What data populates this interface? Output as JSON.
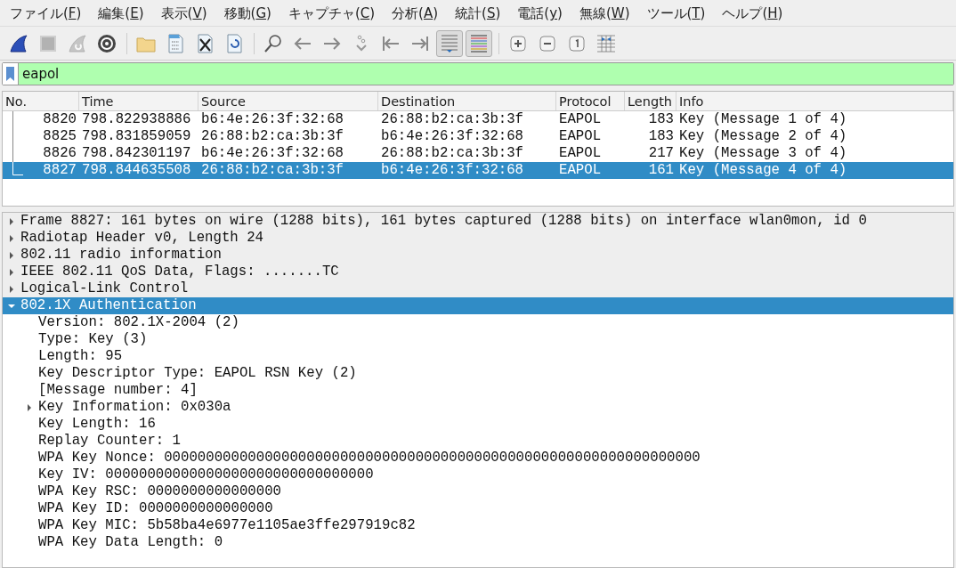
{
  "menu": [
    {
      "before": "ファイル(",
      "accel": "F",
      "after": ")"
    },
    {
      "before": "編集(",
      "accel": "E",
      "after": ")"
    },
    {
      "before": "表示(",
      "accel": "V",
      "after": ")"
    },
    {
      "before": "移動(",
      "accel": "G",
      "after": ")"
    },
    {
      "before": "キャプチャ(",
      "accel": "C",
      "after": ")"
    },
    {
      "before": "分析(",
      "accel": "A",
      "after": ")"
    },
    {
      "before": "統計(",
      "accel": "S",
      "after": ")"
    },
    {
      "before": "電話(",
      "accel": "y",
      "after": ")"
    },
    {
      "before": "無線(",
      "accel": "W",
      "after": ")"
    },
    {
      "before": "ツール(",
      "accel": "T",
      "after": ")"
    },
    {
      "before": "ヘルプ(",
      "accel": "H",
      "after": ")"
    }
  ],
  "toolbar": [
    [
      {
        "kind": "start",
        "pressed": false,
        "disabled": false
      },
      {
        "kind": "stop",
        "pressed": false,
        "disabled": true
      },
      {
        "kind": "restart",
        "pressed": false,
        "disabled": true
      },
      {
        "kind": "options",
        "pressed": false,
        "disabled": false
      }
    ],
    [
      {
        "kind": "open",
        "pressed": false,
        "disabled": false
      },
      {
        "kind": "save",
        "pressed": false,
        "disabled": false
      },
      {
        "kind": "close",
        "pressed": false,
        "disabled": false
      },
      {
        "kind": "reload",
        "pressed": false,
        "disabled": false
      }
    ],
    [
      {
        "kind": "find",
        "pressed": false,
        "disabled": false
      },
      {
        "kind": "back",
        "pressed": false,
        "disabled": false
      },
      {
        "kind": "forward",
        "pressed": false,
        "disabled": false
      },
      {
        "kind": "goto",
        "pressed": false,
        "disabled": false
      },
      {
        "kind": "first",
        "pressed": false,
        "disabled": false
      },
      {
        "kind": "last",
        "pressed": false,
        "disabled": false
      },
      {
        "kind": "autoscroll",
        "pressed": true,
        "disabled": false
      },
      {
        "kind": "colorize",
        "pressed": true,
        "disabled": false
      }
    ],
    [
      {
        "kind": "zoom-in",
        "pressed": false,
        "disabled": false
      },
      {
        "kind": "zoom-out",
        "pressed": false,
        "disabled": false
      },
      {
        "kind": "zoom-reset",
        "pressed": false,
        "disabled": false
      },
      {
        "kind": "resize-columns",
        "pressed": false,
        "disabled": false
      }
    ]
  ],
  "filter": {
    "value": "eapol",
    "valid": true
  },
  "packet_list": {
    "columns": [
      "No.",
      "Time",
      "Source",
      "Destination",
      "Protocol",
      "Length",
      "Info"
    ],
    "rows": [
      {
        "no": "8820",
        "time": "798.822938886",
        "source": "b6:4e:26:3f:32:68",
        "destination": "26:88:b2:ca:3b:3f",
        "protocol": "EAPOL",
        "length": "183",
        "info": "Key (Message 1 of 4)",
        "selected": false
      },
      {
        "no": "8825",
        "time": "798.831859059",
        "source": "26:88:b2:ca:3b:3f",
        "destination": "b6:4e:26:3f:32:68",
        "protocol": "EAPOL",
        "length": "183",
        "info": "Key (Message 2 of 4)",
        "selected": false
      },
      {
        "no": "8826",
        "time": "798.842301197",
        "source": "b6:4e:26:3f:32:68",
        "destination": "26:88:b2:ca:3b:3f",
        "protocol": "EAPOL",
        "length": "217",
        "info": "Key (Message 3 of 4)",
        "selected": false
      },
      {
        "no": "8827",
        "time": "798.844635508",
        "source": "26:88:b2:ca:3b:3f",
        "destination": "b6:4e:26:3f:32:68",
        "protocol": "EAPOL",
        "length": "161",
        "info": "Key (Message 4 of 4)",
        "selected": true
      }
    ]
  },
  "packet_details": [
    {
      "text": "Frame 8827: 161 bytes on wire (1288 bits), 161 bytes captured (1288 bits) on interface wlan0mon, id 0",
      "expanded": false,
      "selected": false
    },
    {
      "text": "Radiotap Header v0, Length 24",
      "expanded": false,
      "selected": false
    },
    {
      "text": "802.11 radio information",
      "expanded": false,
      "selected": false
    },
    {
      "text": "IEEE 802.11 QoS Data, Flags: .......TC",
      "expanded": false,
      "selected": false
    },
    {
      "text": "Logical-Link Control",
      "expanded": false,
      "selected": false
    },
    {
      "text": "802.1X Authentication",
      "expanded": true,
      "selected": true,
      "children": [
        {
          "text": "Version: 802.1X-2004 (2)",
          "selected": false
        },
        {
          "text": "Type: Key (3)",
          "selected": false
        },
        {
          "text": "Length: 95",
          "selected": false
        },
        {
          "text": "Key Descriptor Type: EAPOL RSN Key (2)",
          "selected": false
        },
        {
          "text": "[Message number: 4]",
          "selected": false
        },
        {
          "text": "Key Information: 0x030a",
          "expanded": false,
          "selected": false
        },
        {
          "text": "Key Length: 16",
          "selected": false
        },
        {
          "text": "Replay Counter: 1",
          "selected": false
        },
        {
          "text": "WPA Key Nonce: 0000000000000000000000000000000000000000000000000000000000000000",
          "selected": false
        },
        {
          "text": "Key IV: 00000000000000000000000000000000",
          "selected": false
        },
        {
          "text": "WPA Key RSC: 0000000000000000",
          "selected": false
        },
        {
          "text": "WPA Key ID: 0000000000000000",
          "selected": false
        },
        {
          "text": "WPA Key MIC: 5b58ba4e6977e1105ae3ffe297919c82",
          "selected": false
        },
        {
          "text": "WPA Key Data Length: 0",
          "selected": false
        }
      ]
    }
  ]
}
